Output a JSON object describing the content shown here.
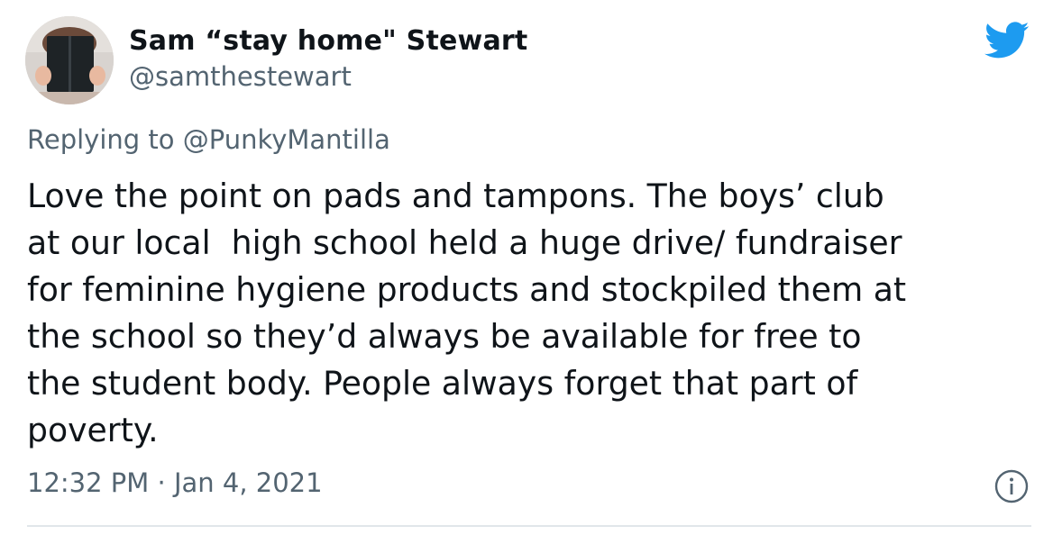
{
  "author": {
    "display_name": "Sam “stay home\" Stewart",
    "handle": "@samthestewart",
    "avatar_icon": "person-reading-book-avatar"
  },
  "reply": {
    "prefix": "Replying to ",
    "handle": "@PunkyMantilla"
  },
  "body": {
    "lines": [
      "Love the point on pads and tampons. The boys’ club",
      "at our local  high school held a huge drive/ fundraiser",
      "for feminine hygiene products and stockpiled them at",
      "the school so they’d always be available for free to",
      "the student body. People always forget that part of",
      "poverty."
    ]
  },
  "meta": {
    "timestamp": "12:32 PM · Jan 4, 2021"
  },
  "icons": {
    "brand": "twitter-bird-icon",
    "info": "info-icon"
  },
  "colors": {
    "brand": "#1d9bf0",
    "text": "#0f1419",
    "secondary": "#536471",
    "divider": "#e1e6ea"
  }
}
